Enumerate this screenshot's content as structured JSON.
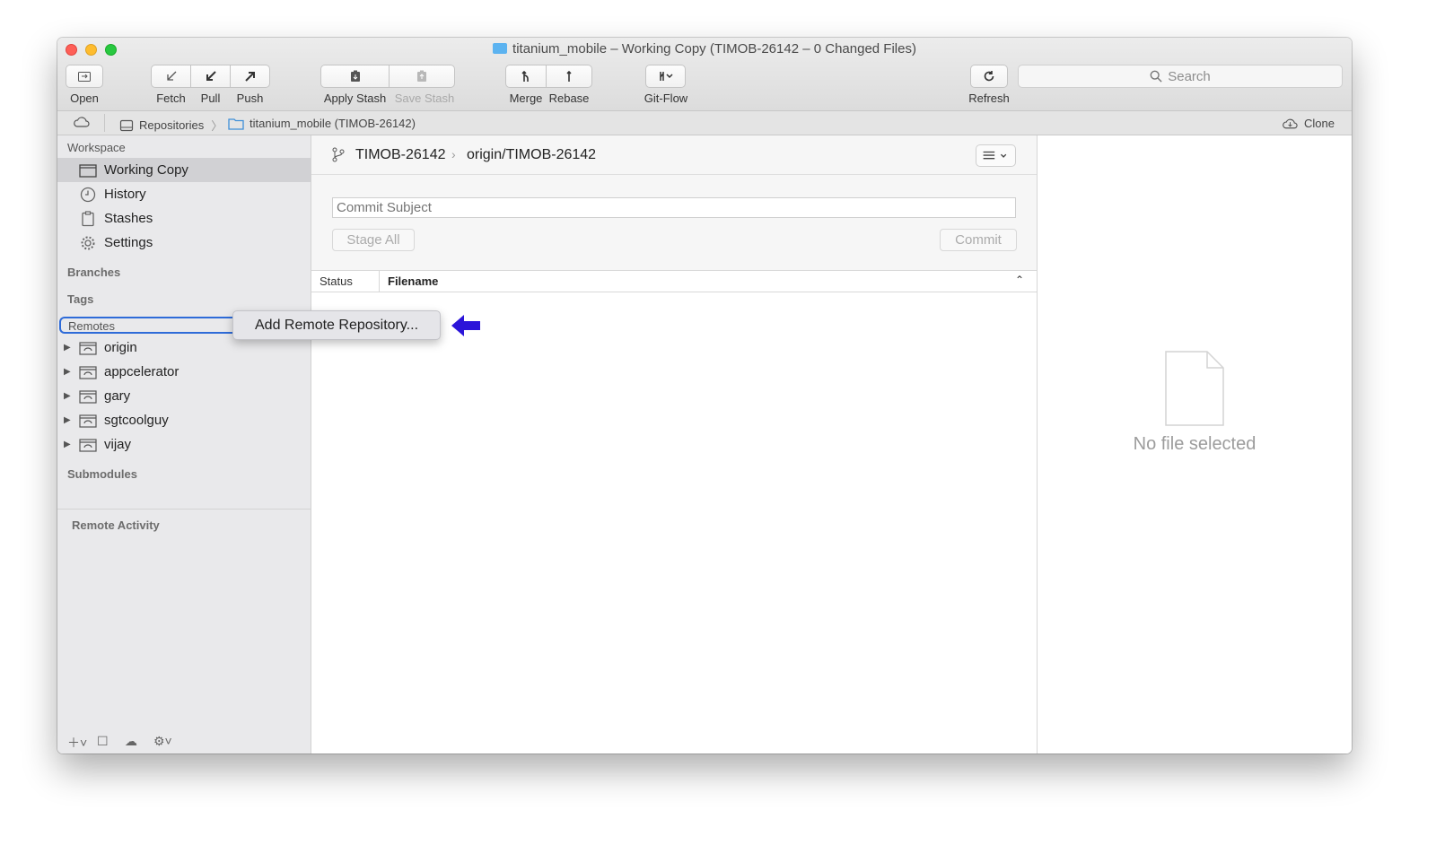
{
  "window": {
    "title": "titanium_mobile – Working Copy (TIMOB-26142 – 0 Changed Files)"
  },
  "toolbar": {
    "open": "Open",
    "fetch": "Fetch",
    "pull": "Pull",
    "push": "Push",
    "apply_stash": "Apply Stash",
    "save_stash": "Save Stash",
    "merge": "Merge",
    "rebase": "Rebase",
    "git_flow": "Git-Flow",
    "refresh": "Refresh",
    "search_placeholder": "Search"
  },
  "pathbar": {
    "repositories": "Repositories",
    "current_repo": "titanium_mobile (TIMOB-26142)",
    "clone": "Clone"
  },
  "sidebar": {
    "workspace_header": "Workspace",
    "workspace_items": [
      {
        "label": "Working Copy",
        "icon": "folder-icon",
        "selected": true
      },
      {
        "label": "History",
        "icon": "clock-icon"
      },
      {
        "label": "Stashes",
        "icon": "clipboard-icon"
      },
      {
        "label": "Settings",
        "icon": "gear-icon"
      }
    ],
    "branches_header": "Branches",
    "tags_header": "Tags",
    "remotes_header": "Remotes",
    "remotes": [
      "origin",
      "appcelerator",
      "gary",
      "sgtcoolguy",
      "vijay"
    ],
    "submodules_header": "Submodules",
    "remote_activity": "Remote Activity"
  },
  "context_menu": {
    "add_remote": "Add Remote Repository..."
  },
  "main": {
    "local_branch": "TIMOB-26142",
    "remote_branch": "origin/TIMOB-26142",
    "commit_placeholder": "Commit Subject",
    "stage_all": "Stage All",
    "commit": "Commit",
    "columns": {
      "status": "Status",
      "filename": "Filename"
    }
  },
  "preview": {
    "empty_text": "No file selected"
  },
  "colors": {
    "accent_arrow": "#2b14d9",
    "focus_ring": "#2e6bd8"
  }
}
